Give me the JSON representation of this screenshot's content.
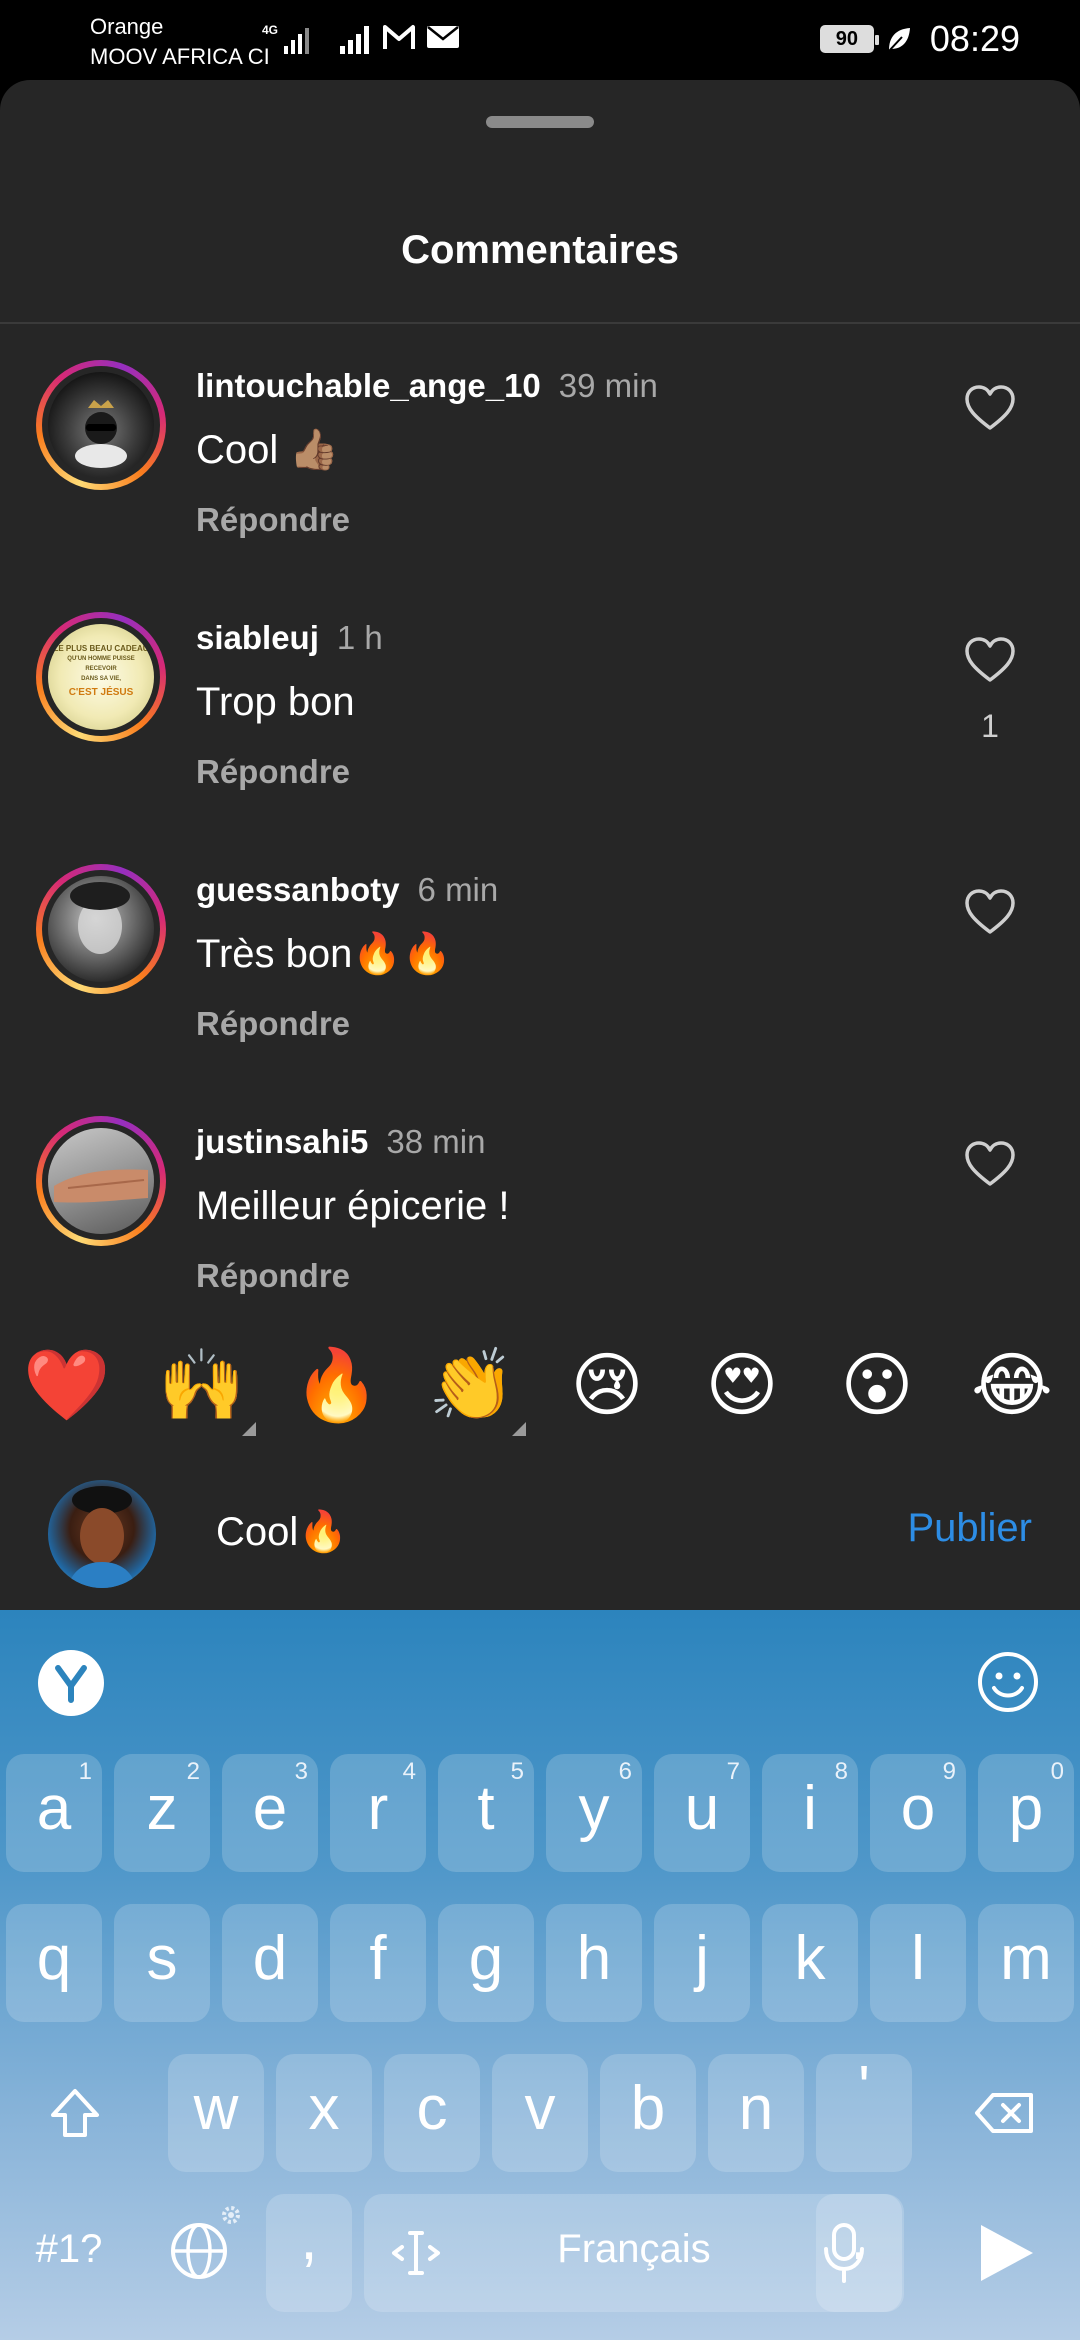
{
  "status_bar": {
    "carrier_line1": "Orange",
    "carrier_line2": "MOOV AFRICA CI",
    "network": "4G",
    "battery": "90",
    "time": "08:29"
  },
  "sheet": {
    "title": "Commentaires"
  },
  "comments": [
    {
      "username": "lintouchable_ange_10",
      "time": "39 min",
      "text": "Cool 👍🏽",
      "reply": "Répondre",
      "likes": ""
    },
    {
      "username": "siableuj",
      "time": "1 h",
      "text": "Trop bon",
      "reply": "Répondre",
      "likes": "1"
    },
    {
      "username": "guessanboty",
      "time": "6 min",
      "text": "Très bon🔥🔥",
      "reply": "Répondre",
      "likes": ""
    },
    {
      "username": "justinsahi5",
      "time": "38 min",
      "text": "Meilleur épicerie !",
      "reply": "Répondre",
      "likes": ""
    }
  ],
  "avatar_text": {
    "siableuj": [
      "LE PLUS BEAU CADEAU",
      "QU'UN HOMME PUISSE RECEVOIR",
      "DANS SA VIE,",
      "C'EST JÉSUS"
    ]
  },
  "emoji_bar": [
    "❤️",
    "🙌",
    "🔥",
    "👏",
    "😢",
    "😍",
    "😮",
    "😂"
  ],
  "composer": {
    "value": "Cool🔥",
    "publish_label": "Publier"
  },
  "keyboard": {
    "row1": [
      {
        "key": "a",
        "hint": "1"
      },
      {
        "key": "z",
        "hint": "2"
      },
      {
        "key": "e",
        "hint": "3"
      },
      {
        "key": "r",
        "hint": "4"
      },
      {
        "key": "t",
        "hint": "5"
      },
      {
        "key": "y",
        "hint": "6"
      },
      {
        "key": "u",
        "hint": "7"
      },
      {
        "key": "i",
        "hint": "8"
      },
      {
        "key": "o",
        "hint": "9"
      },
      {
        "key": "p",
        "hint": "0"
      }
    ],
    "row2": [
      "q",
      "s",
      "d",
      "f",
      "g",
      "h",
      "j",
      "k",
      "l",
      "m"
    ],
    "row3": [
      "w",
      "x",
      "c",
      "v",
      "b",
      "n",
      "'"
    ],
    "symbols_label": "#1?",
    "comma": ",",
    "space_label": "Français",
    "period": ".",
    "accent_color": "#2d8de5"
  }
}
